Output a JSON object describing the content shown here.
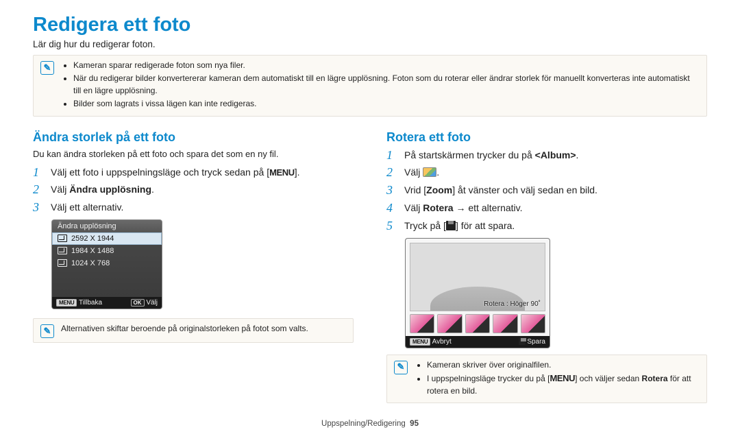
{
  "title": "Redigera ett foto",
  "intro": "Lär dig hur du redigerar foton.",
  "top_note": {
    "items": [
      "Kameran sparar redigerade foton som nya filer.",
      "När du redigerar bilder konvertererar kameran dem automatiskt till en lägre upplösning. Foton som du roterar eller ändrar storlek för manuellt konverteras inte automatiskt till en lägre upplösning.",
      "Bilder som lagrats i vissa lägen kan inte redigeras."
    ]
  },
  "left": {
    "heading": "Ändra storlek på ett foto",
    "sub": "Du kan ändra storleken på ett foto och spara det som en ny fil.",
    "steps": {
      "s1_pre": "Välj ett foto i uppspelningsläge och tryck sedan på [",
      "s1_menu": "MENU",
      "s1_post": "].",
      "s2_pre": "Välj ",
      "s2_bold": "Ändra upplösning",
      "s2_post": ".",
      "s3": "Välj ett alternativ."
    },
    "dialog": {
      "title": "Ändra upplösning",
      "r1": "2592 X 1944",
      "r2": "1984 X 1488",
      "r3": "1024 X 768",
      "back": "Tillbaka",
      "select": "Välj",
      "menu_chip": "MENU",
      "ok_chip": "OK"
    },
    "note": "Alternativen skiftar beroende på originalstorleken på fotot som valts."
  },
  "right": {
    "heading": "Rotera ett foto",
    "steps": {
      "s1_pre": "På startskärmen trycker du på ",
      "s1_bold": "<Album>",
      "s1_post": ".",
      "s2": "Välj ",
      "s3_pre": "Vrid [",
      "s3_bold": "Zoom",
      "s3_post": "] åt vänster och välj sedan en bild.",
      "s4_pre": "Välj ",
      "s4_bold": "Rotera",
      "s4_arrow": " → ",
      "s4_post": "ett alternativ.",
      "s5_pre": "Tryck på [",
      "s5_post": "] för att spara."
    },
    "dialog": {
      "caption": "Rotera : Höger 90˚",
      "cancel": "Avbryt",
      "save": "Spara",
      "menu_chip": "MENU"
    },
    "note": {
      "items": [
        "Kameran skriver över originalfilen.",
        "I uppspelningsläge trycker du på [MENU] och väljer sedan Rotera för att rotera en bild."
      ],
      "b_menu": "MENU",
      "b_rotera": "Rotera"
    }
  },
  "footer": {
    "section": "Uppspelning/Redigering",
    "page": "95"
  }
}
